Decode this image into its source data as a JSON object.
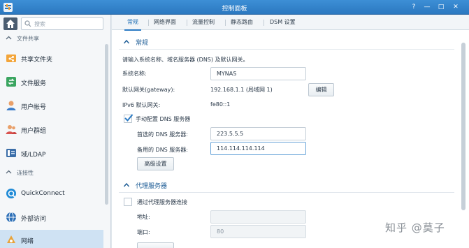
{
  "window": {
    "title": "控制面板",
    "controls": [
      "?",
      "—",
      "□",
      "✕"
    ]
  },
  "sidebar": {
    "search_placeholder": "搜索",
    "sections": [
      {
        "label": "文件共享"
      },
      {
        "label": "连接性"
      }
    ],
    "items": [
      {
        "label": "共享文件夹",
        "icon": "share-folder-icon"
      },
      {
        "label": "文件服务",
        "icon": "file-service-icon"
      },
      {
        "label": "用户帐号",
        "icon": "user-icon"
      },
      {
        "label": "用户群组",
        "icon": "group-icon"
      },
      {
        "label": "域/LDAP",
        "icon": "domain-icon"
      },
      {
        "label": "QuickConnect",
        "icon": "quickconnect-icon"
      },
      {
        "label": "外部访问",
        "icon": "globe-icon"
      },
      {
        "label": "网络",
        "icon": "network-icon"
      }
    ]
  },
  "tabs": [
    {
      "label": "常规",
      "active": true
    },
    {
      "label": "网络界面"
    },
    {
      "label": "流量控制"
    },
    {
      "label": "静态路由"
    },
    {
      "label": "DSM 设置"
    }
  ],
  "general": {
    "heading": "常规",
    "description": "请输入系统名称、域名服务器 (DNS) 及默认网关。",
    "system_name_label": "系统名称:",
    "system_name_value": "MYNAS",
    "gateway_label": "默认网关(gateway):",
    "gateway_value": "192.168.1.1 (局域网 1)",
    "edit_button": "编辑",
    "ipv6_label": "IPv6 默认网关:",
    "ipv6_value": "fe80::1",
    "manual_dns_label": "手动配置 DNS 服务器",
    "manual_dns_checked": true,
    "preferred_dns_label": "首选的 DNS 服务器:",
    "preferred_dns_value": "223.5.5.5",
    "alternate_dns_label": "备用的 DNS 服务器:",
    "alternate_dns_value": "114.114.114.114",
    "advanced_button": "高级设置"
  },
  "proxy": {
    "heading": "代理服务器",
    "connect_label": "通过代理服务器连接",
    "connect_checked": false,
    "address_label": "地址:",
    "address_value": "",
    "port_label": "端口:",
    "port_value": "80"
  },
  "watermark": "知乎 @莫子",
  "colors": {
    "titlebar": "#2b78c0",
    "accent": "#1f6fb5",
    "active_nav": "#cfe2f3"
  }
}
